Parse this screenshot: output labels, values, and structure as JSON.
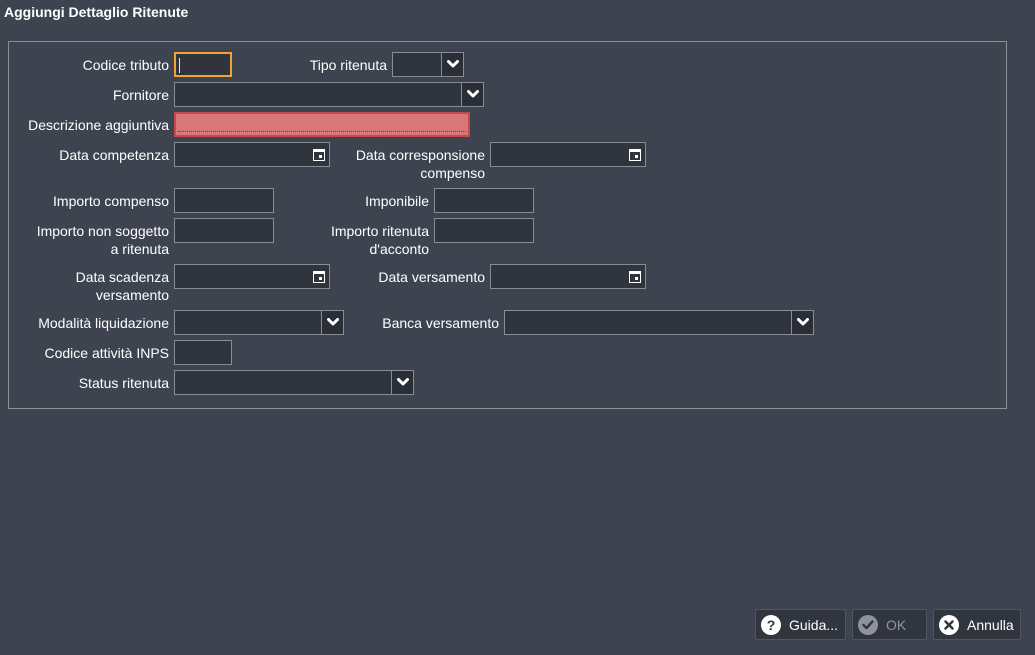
{
  "window": {
    "title": "Aggiungi Dettaglio Ritenute"
  },
  "form": {
    "codice_tributo": {
      "label": "Codice tributo",
      "value": ""
    },
    "tipo_ritenuta": {
      "label": "Tipo ritenuta",
      "value": ""
    },
    "fornitore": {
      "label": "Fornitore",
      "value": ""
    },
    "descrizione_aggiuntiva": {
      "label": "Descrizione aggiuntiva",
      "value": ""
    },
    "data_competenza": {
      "label": "Data competenza",
      "value": ""
    },
    "data_corresponsione_compenso": {
      "label": "Data corresponsione\ncompenso",
      "value": ""
    },
    "importo_compenso": {
      "label": "Importo compenso",
      "value": ""
    },
    "imponibile": {
      "label": "Imponibile",
      "value": ""
    },
    "importo_non_soggetto": {
      "label": "Importo non soggetto\na ritenuta",
      "value": ""
    },
    "importo_ritenuta_acconto": {
      "label": "Importo ritenuta\nd'acconto",
      "value": ""
    },
    "data_scadenza_versamento": {
      "label": "Data scadenza\nversamento",
      "value": ""
    },
    "data_versamento": {
      "label": "Data versamento",
      "value": ""
    },
    "modalita_liquidazione": {
      "label": "Modalità liquidazione",
      "value": ""
    },
    "banca_versamento": {
      "label": "Banca versamento",
      "value": ""
    },
    "codice_attivita_inps": {
      "label": "Codice attività INPS",
      "value": ""
    },
    "status_ritenuta": {
      "label": "Status ritenuta",
      "value": ""
    }
  },
  "buttons": {
    "help": {
      "label": "Guida...",
      "icon": "question-icon"
    },
    "ok": {
      "label": "OK",
      "icon": "check-icon",
      "enabled": false
    },
    "cancel": {
      "label": "Annulla",
      "icon": "close-icon"
    }
  },
  "colors": {
    "background": "#3e4350",
    "field_background": "#30343d",
    "focus_border": "#f0a233",
    "error_fill": "#d97678"
  }
}
